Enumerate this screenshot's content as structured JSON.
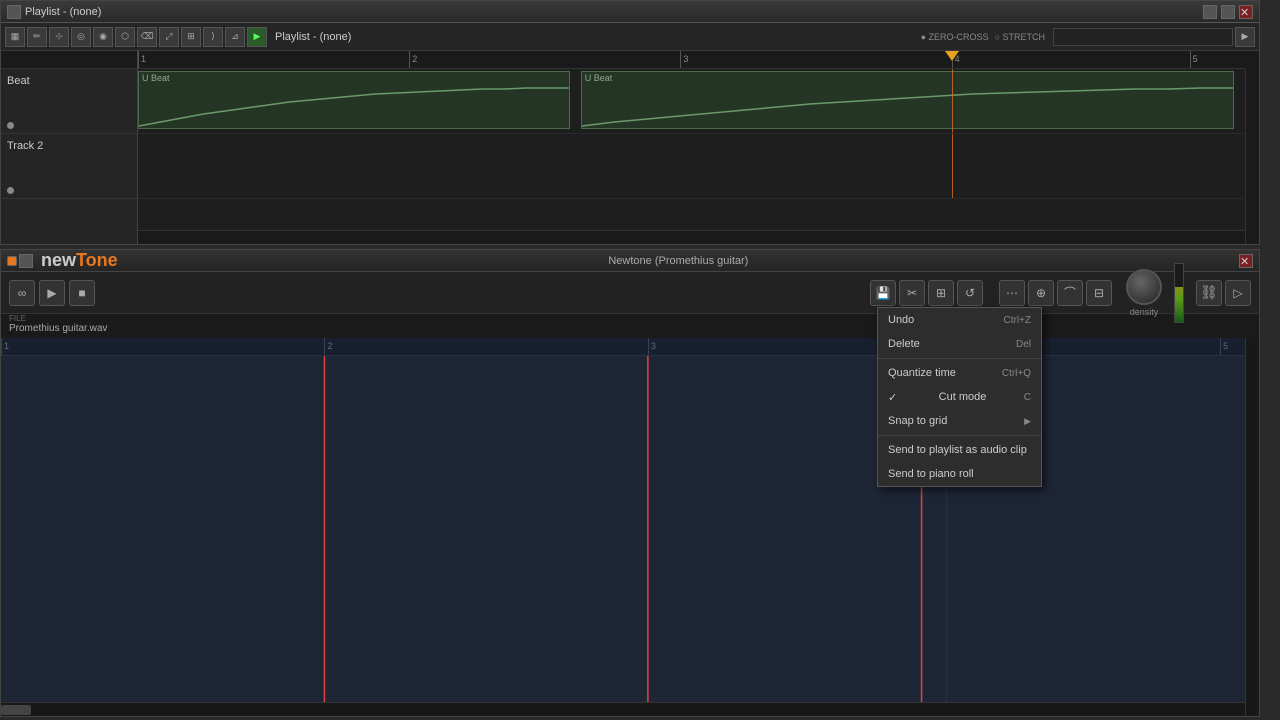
{
  "topPanel": {
    "title": "Playlist - (none)",
    "tracks": [
      {
        "label": "Beat",
        "clips": [
          {
            "label": "U Beat",
            "startPct": 0,
            "widthPct": 39,
            "color": "#2a3a2a"
          },
          {
            "label": "U Beat",
            "startPct": 40,
            "widthPct": 59,
            "color": "#2a3a2a"
          }
        ]
      },
      {
        "label": "Track 2",
        "clips": []
      }
    ]
  },
  "bottomPanel": {
    "title": "Newtone (Promethius guitar)",
    "logoNew": "new",
    "logoTone": "Tone",
    "fileTitle": "FILE",
    "fileName": "Promethius guitar.wav",
    "densityLabel": "density"
  },
  "contextMenu": {
    "items": [
      {
        "label": "Undo",
        "shortcut": "Ctrl+Z",
        "type": "normal"
      },
      {
        "label": "Delete",
        "shortcut": "Del",
        "type": "normal"
      },
      {
        "separator": true
      },
      {
        "label": "Quantize time",
        "shortcut": "Ctrl+Q",
        "type": "normal"
      },
      {
        "label": "Cut mode",
        "shortcut": "C",
        "type": "check"
      },
      {
        "label": "Snap to grid",
        "shortcut": "",
        "type": "submenu"
      },
      {
        "label": "Send to playlist as audio clip",
        "shortcut": "",
        "type": "normal"
      },
      {
        "label": "Send to piano roll",
        "shortcut": "",
        "type": "normal"
      }
    ]
  },
  "ruler": {
    "marks": [
      "2",
      "3",
      "4",
      "5"
    ],
    "markPositions": [
      "25%",
      "49%",
      "73.5%",
      "97%"
    ]
  },
  "wfRuler": {
    "marks": [
      "2",
      "3",
      "4",
      "5"
    ],
    "markPositions": [
      "26%",
      "52%",
      "77%",
      "100%"
    ]
  },
  "playheadPos": "78%",
  "wfPlayheads": [
    "26%",
    "52%",
    "74%"
  ]
}
